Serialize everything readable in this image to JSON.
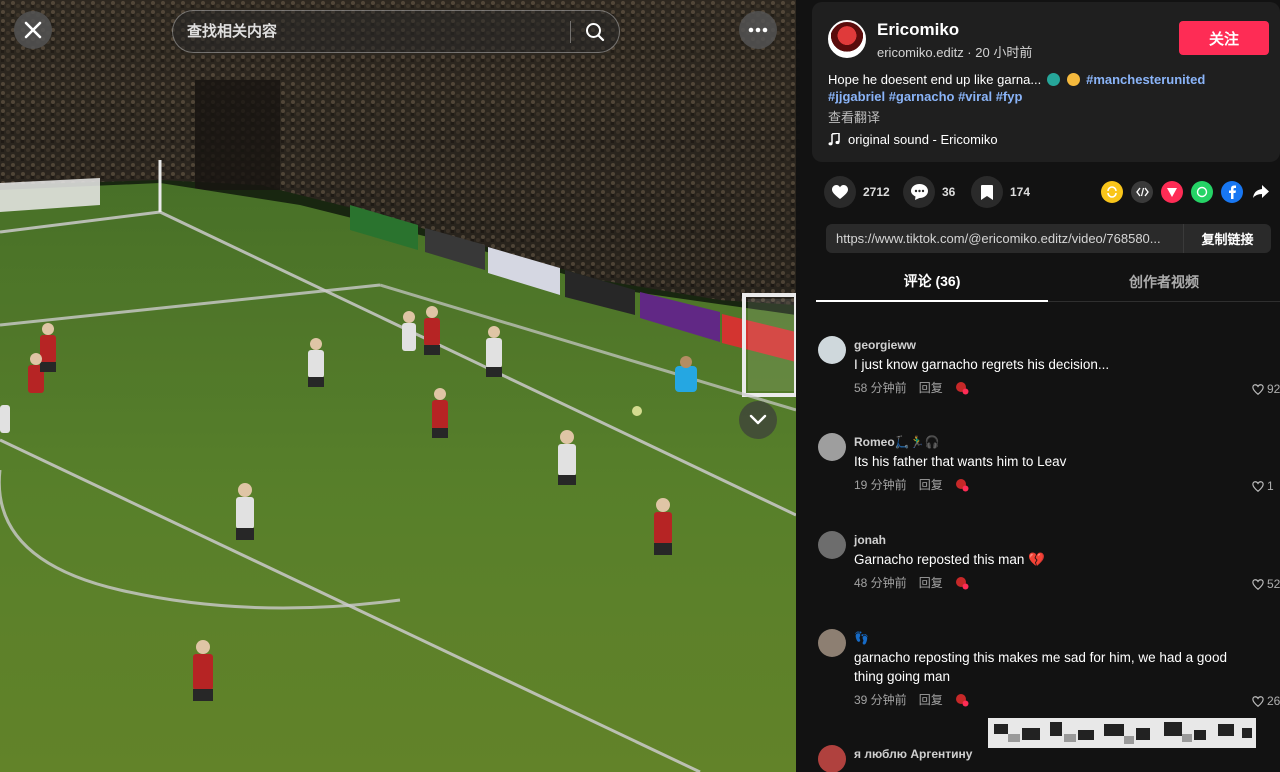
{
  "search": {
    "placeholder": "查找相关内容"
  },
  "author": {
    "name": "Ericomiko",
    "handle_time": "ericomiko.editz · 20 小时前",
    "follow_label": "关注"
  },
  "description": {
    "text": "Hope he doesent end up like garna...",
    "hashtags": [
      "#manchesterunited",
      "#jjgabriel",
      "#garnacho",
      "#viral",
      "#fyp"
    ],
    "translate": "查看翻译",
    "sound": "original sound - Ericomiko"
  },
  "stats": {
    "likes": "2712",
    "comments": "36",
    "saves": "174"
  },
  "share": {
    "link": "https://www.tiktok.com/@ericomiko.editz/video/768580...",
    "copy_label": "复制链接"
  },
  "tabs": [
    {
      "label": "评论 (36)",
      "active": true
    },
    {
      "label": "创作者视频",
      "active": false
    }
  ],
  "comments": [
    {
      "user": "georgieww",
      "text": "I just know garnacho regrets his decision...",
      "time": "58 分钟前",
      "reply": "回复",
      "likes": "92",
      "avatar_color": "#cfd8dc"
    },
    {
      "user": "Romeo🛴🏃‍♂️🎧",
      "text": "Its his father that wants him to Leav",
      "time": "19 分钟前",
      "reply": "回复",
      "likes": "1",
      "avatar_color": "#9e9e9e"
    },
    {
      "user": "jonah",
      "text": "Garnacho reposted this man 💔",
      "time": "48 分钟前",
      "reply": "回复",
      "likes": "52",
      "avatar_color": "#6d6d6d"
    },
    {
      "user": "👣",
      "text": "garnacho reposting this makes me sad for him, we had a good thing going man",
      "time": "39 分钟前",
      "reply": "回复",
      "likes": "26",
      "avatar_color": "#8d7f72"
    },
    {
      "user": "я люблю Аргентину",
      "text": "",
      "time": "",
      "reply": "",
      "likes": "",
      "avatar_color": "#b0413e"
    }
  ],
  "colors": {
    "accent": "#fe2c55",
    "hashtag": "#8ab4f8",
    "panel_bg": "#121212",
    "card_bg": "#1f1f1f"
  },
  "icons": [
    "close-icon",
    "search-icon",
    "more-icon",
    "chevron-down-icon",
    "heart-icon",
    "comment-icon",
    "bookmark-icon",
    "music-note-icon",
    "share-arrow-icon"
  ]
}
